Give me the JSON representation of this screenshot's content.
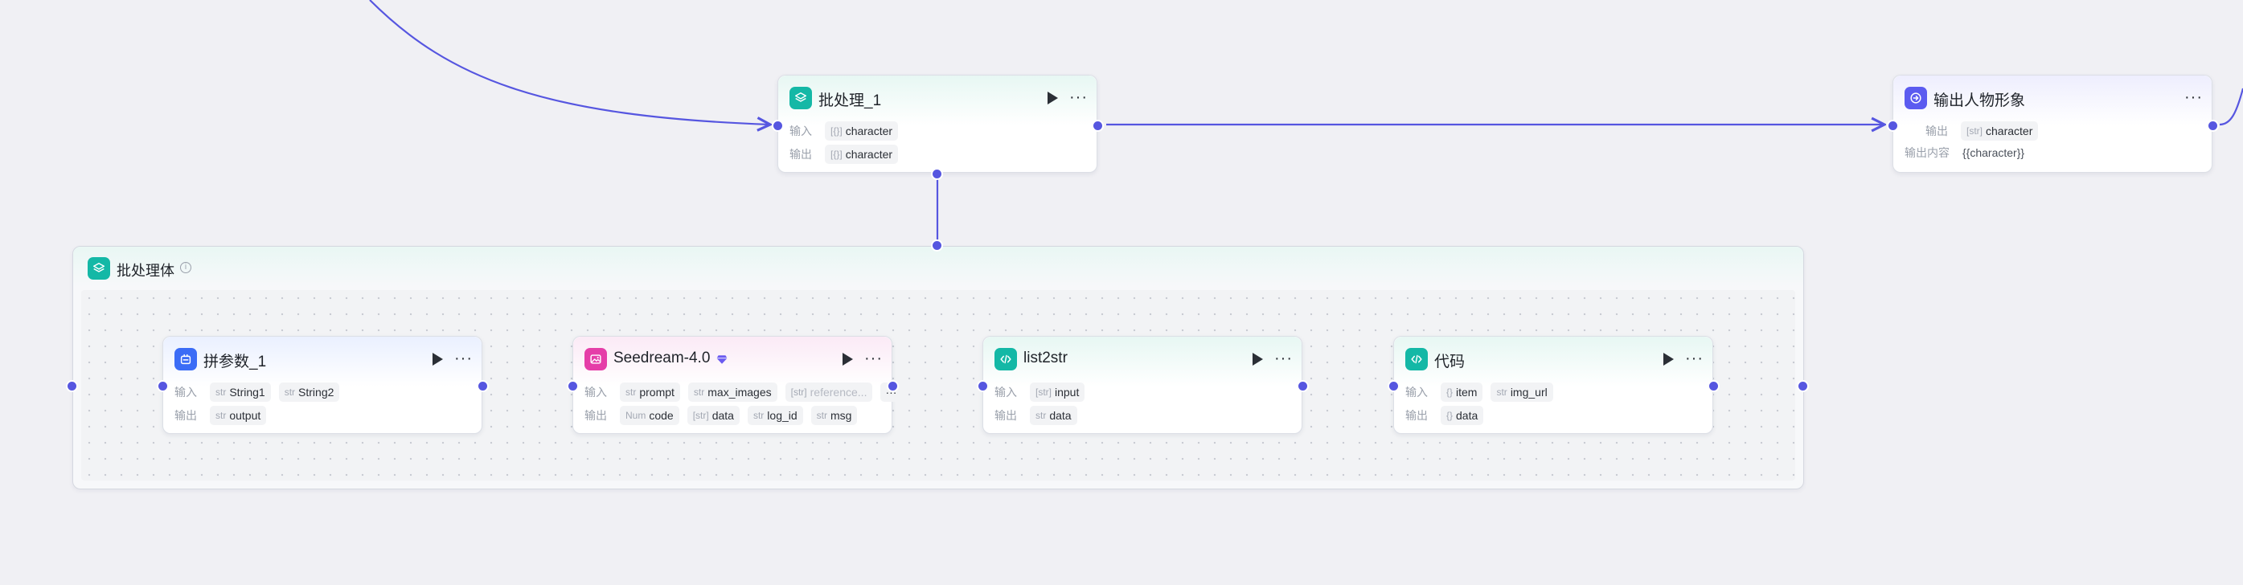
{
  "labels": {
    "input": "输入",
    "output": "输出",
    "output_content": "输出内容"
  },
  "nodes": {
    "batch": {
      "title": "批处理_1",
      "inputs": [
        {
          "type": "[{}]",
          "name": "character"
        }
      ],
      "outputs": [
        {
          "type": "[{}]",
          "name": "character"
        }
      ]
    },
    "end": {
      "title": "输出人物形象",
      "outputs": [
        {
          "type": "[str]",
          "name": "character"
        }
      ],
      "output_content": "{{character}}"
    },
    "concat": {
      "title": "拼参数_1",
      "inputs": [
        {
          "type": "str",
          "name": "String1"
        },
        {
          "type": "str",
          "name": "String2"
        }
      ],
      "outputs": [
        {
          "type": "str",
          "name": "output"
        }
      ]
    },
    "seedream": {
      "title": "Seedream-4.0",
      "inputs": [
        {
          "type": "str",
          "name": "prompt"
        },
        {
          "type": "str",
          "name": "max_images"
        },
        {
          "type": "[str]",
          "name": "reference..."
        }
      ],
      "more": "···",
      "outputs": [
        {
          "type": "Num",
          "name": "code"
        },
        {
          "type": "[str]",
          "name": "data"
        },
        {
          "type": "str",
          "name": "log_id"
        },
        {
          "type": "str",
          "name": "msg"
        }
      ]
    },
    "list2str": {
      "title": "list2str",
      "inputs": [
        {
          "type": "[str]",
          "name": "input"
        }
      ],
      "outputs": [
        {
          "type": "str",
          "name": "data"
        }
      ]
    },
    "code": {
      "title": "代码",
      "inputs": [
        {
          "type": "{}",
          "name": "item"
        },
        {
          "type": "str",
          "name": "img_url"
        }
      ],
      "outputs": [
        {
          "type": "{}",
          "name": "data"
        }
      ]
    }
  },
  "batch_body": {
    "title": "批处理体"
  },
  "colors": {
    "edge": "#5656e0",
    "accent_teal": "#14b8a6",
    "accent_blue": "#3b6cf6",
    "accent_pink": "#e53ea8",
    "accent_indigo": "#5b5bf0"
  },
  "icons": {
    "batch": "layers-icon",
    "end": "exit-icon",
    "concat": "puzzle-icon",
    "seedream": "image-icon",
    "list2str": "code-icon",
    "code": "code-icon",
    "vip": "diamond-icon",
    "run": "play-icon",
    "more": "more-icon",
    "info": "info-icon"
  }
}
